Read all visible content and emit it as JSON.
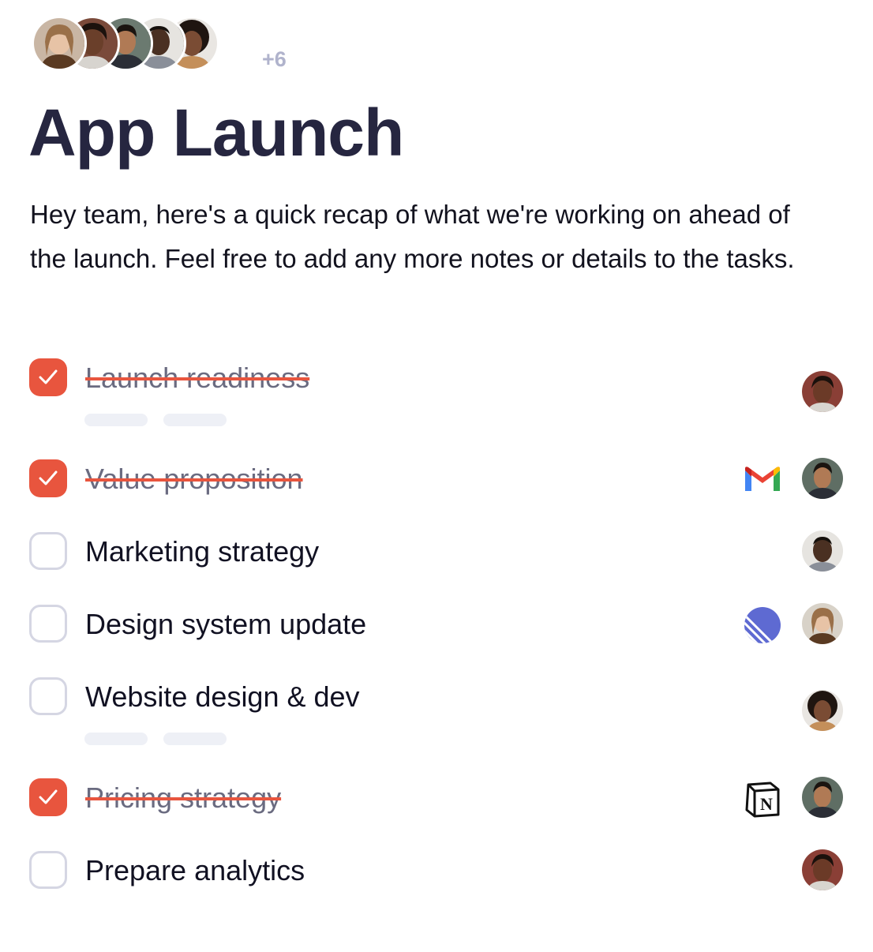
{
  "header": {
    "avatars": [
      "woman-blonde-avatar",
      "woman-curly-avatar",
      "man-smiling-avatar",
      "man-portrait-avatar",
      "woman-afro-avatar"
    ],
    "more_count": "+6"
  },
  "title": "App Launch",
  "intro": "Hey team, here's a quick recap of what we're working on ahead of the launch. Feel free to add any more notes or details to the tasks.",
  "colors": {
    "accent": "#e8553e",
    "title": "#262640",
    "muted": "#b0b3cc"
  },
  "tasks": [
    {
      "label": "Launch readiness",
      "done": true,
      "app": null,
      "assignee": "woman-dark-avatar",
      "has_placeholder": true
    },
    {
      "label": "Value proposition",
      "done": true,
      "app": "gmail-icon",
      "assignee": "man-smiling-avatar",
      "has_placeholder": false
    },
    {
      "label": "Marketing strategy",
      "done": false,
      "app": null,
      "assignee": "man-portrait-avatar",
      "has_placeholder": false
    },
    {
      "label": "Design system update",
      "done": false,
      "app": "linear-icon",
      "assignee": "woman-blonde-avatar",
      "has_placeholder": false
    },
    {
      "label": "Website design & dev",
      "done": false,
      "app": null,
      "assignee": "woman-afro-avatar",
      "has_placeholder": true
    },
    {
      "label": "Pricing strategy",
      "done": true,
      "app": "notion-icon",
      "assignee": "man-smiling-avatar",
      "has_placeholder": false
    },
    {
      "label": "Prepare analytics",
      "done": false,
      "app": null,
      "assignee": "woman-dark-avatar",
      "has_placeholder": false
    }
  ]
}
